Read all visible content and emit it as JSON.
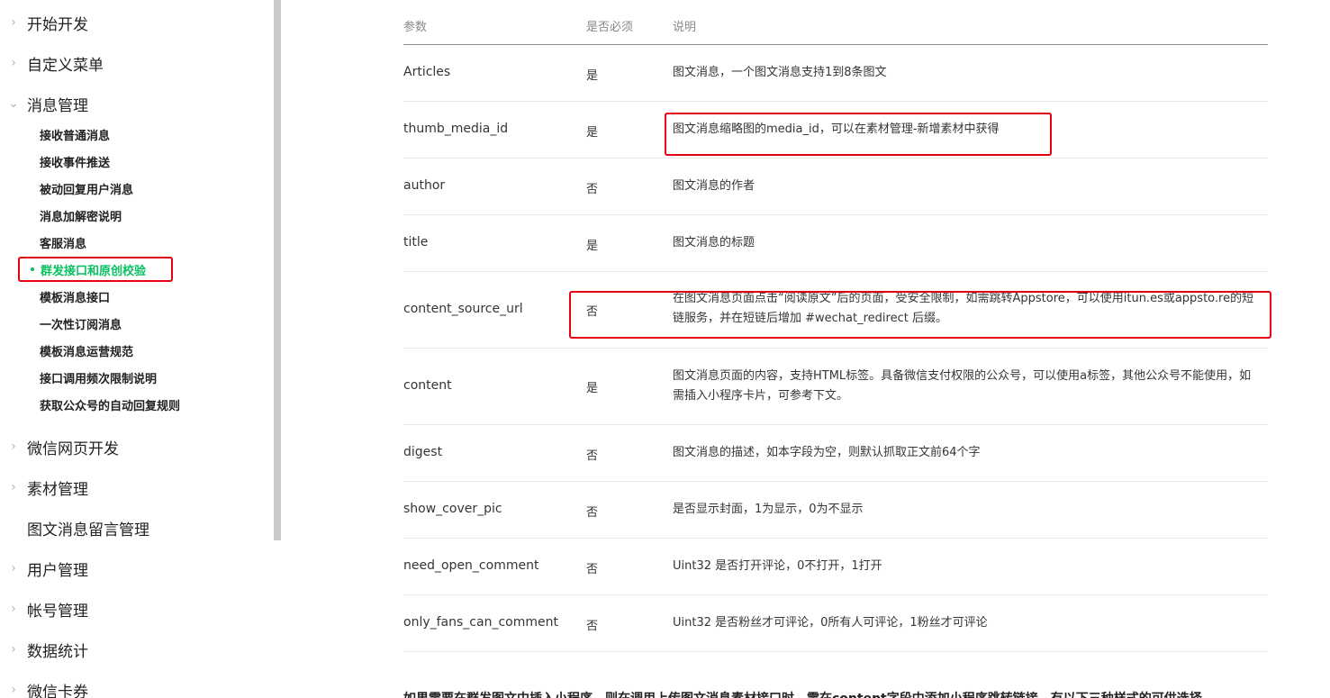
{
  "sidebar": {
    "top_items": [
      {
        "label": "开始开发",
        "chev": "›"
      },
      {
        "label": "自定义菜单",
        "chev": "›"
      },
      {
        "label": "消息管理",
        "chev": "⌄"
      }
    ],
    "sub_items": [
      "接收普通消息",
      "接收事件推送",
      "被动回复用户消息",
      "消息加解密说明",
      "客服消息",
      "群发接口和原创校验",
      "模板消息接口",
      "一次性订阅消息",
      "模板消息运营规范",
      "接口调用频次限制说明",
      "获取公众号的自动回复规则"
    ],
    "bottom_items": [
      {
        "label": "微信网页开发",
        "chev": "›"
      },
      {
        "label": "素材管理",
        "chev": "›"
      },
      {
        "label": "图文消息留言管理",
        "chev": ""
      },
      {
        "label": "用户管理",
        "chev": "›"
      },
      {
        "label": "帐号管理",
        "chev": "›"
      },
      {
        "label": "数据统计",
        "chev": "›"
      },
      {
        "label": "微信卡券",
        "chev": "›"
      }
    ]
  },
  "table": {
    "headers": {
      "param": "参数",
      "required": "是否必须",
      "desc": "说明"
    },
    "rows": [
      {
        "name": "Articles",
        "required": "是",
        "desc": "图文消息，一个图文消息支持1到8条图文"
      },
      {
        "name": "thumb_media_id",
        "required": "是",
        "desc": "图文消息缩略图的media_id，可以在素材管理-新增素材中获得"
      },
      {
        "name": "author",
        "required": "否",
        "desc": "图文消息的作者"
      },
      {
        "name": "title",
        "required": "是",
        "desc": "图文消息的标题"
      },
      {
        "name": "content_source_url",
        "required": "否",
        "desc": "在图文消息页面点击“阅读原文”后的页面，受安全限制，如需跳转Appstore，可以使用itun.es或appsto.re的短链服务，并在短链后增加 #wechat_redirect 后缀。"
      },
      {
        "name": "content",
        "required": "是",
        "desc": "图文消息页面的内容，支持HTML标签。具备微信支付权限的公众号，可以使用a标签，其他公众号不能使用，如需插入小程序卡片，可参考下文。"
      },
      {
        "name": "digest",
        "required": "否",
        "desc": "图文消息的描述，如本字段为空，则默认抓取正文前64个字"
      },
      {
        "name": "show_cover_pic",
        "required": "否",
        "desc": "是否显示封面，1为显示，0为不显示"
      },
      {
        "name": "need_open_comment",
        "required": "否",
        "desc": "Uint32 是否打开评论，0不打开，1打开"
      },
      {
        "name": "only_fans_can_comment",
        "required": "否",
        "desc": "Uint32 是否粉丝才可评论，0所有人可评论，1粉丝才可评论"
      }
    ]
  },
  "bottom_text": "如果需要在群发图文中插入小程序，则在调用上传图文消息素材接口时，需在content字段中添加小程序跳转链接，有以下三种样式的可供选择。",
  "colors": {
    "active": "#07c160",
    "highlight": "#e60012"
  }
}
